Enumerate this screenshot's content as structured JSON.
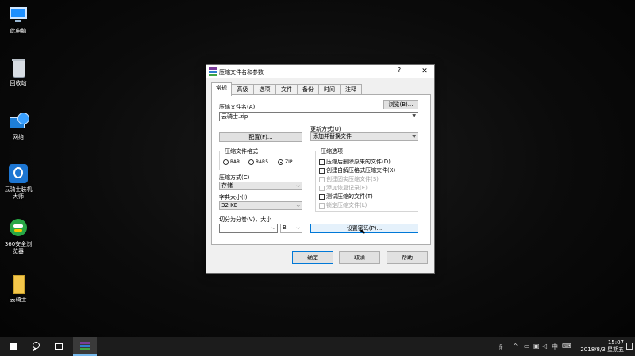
{
  "desktop": {
    "icons": [
      {
        "label": "此电脑",
        "icon": "computer-icon"
      },
      {
        "label": "回收站",
        "icon": "recycle-bin-icon"
      },
      {
        "label": "网络",
        "icon": "network-icon"
      },
      {
        "label": "云骑士装机大师",
        "icon": "yunqishi-installer-icon"
      },
      {
        "label": "360安全浏览器",
        "icon": "360-browser-icon"
      },
      {
        "label": "云骑士",
        "icon": "folder-icon"
      }
    ]
  },
  "dialog": {
    "title": "压缩文件名和参数",
    "help_label": "?",
    "close_label": "✕",
    "tabs": [
      "常规",
      "高级",
      "选项",
      "文件",
      "备份",
      "时间",
      "注释"
    ],
    "active_tab": "常规",
    "archive_name_label": "压缩文件名(A)",
    "browse_label": "浏览(B)...",
    "archive_name_value": "云骑士.zip",
    "profile_label": "配置(F)...",
    "update_mode_label": "更新方式(U)",
    "update_mode_value": "添加并替换文件",
    "format_group_label": "压缩文件格式",
    "formats": [
      "RAR",
      "RAR5",
      "ZIP"
    ],
    "selected_format": "ZIP",
    "options_group_label": "压缩选项",
    "options": [
      {
        "label": "压缩后删除原来的文件(D)",
        "enabled": true,
        "checked": false
      },
      {
        "label": "创建自解压格式压缩文件(X)",
        "enabled": true,
        "checked": false
      },
      {
        "label": "创建固实压缩文件(S)",
        "enabled": false,
        "checked": false
      },
      {
        "label": "添加恢复记录(E)",
        "enabled": false,
        "checked": false
      },
      {
        "label": "测试压缩的文件(T)",
        "enabled": true,
        "checked": false
      },
      {
        "label": "锁定压缩文件(L)",
        "enabled": false,
        "checked": false
      }
    ],
    "method_label": "压缩方式(C)",
    "method_value": "存储",
    "dict_label": "字典大小(I)",
    "dict_value": "32 KB",
    "split_label": "切分为分卷(V)，大小",
    "split_value": "",
    "split_unit": "B",
    "password_label": "设置密码(P)...",
    "ok_label": "确定",
    "cancel_label": "取消",
    "help_button_label": "帮助"
  },
  "taskbar": {
    "time": "15:07",
    "date": "2018/8/3 星期五",
    "ime": "中"
  }
}
